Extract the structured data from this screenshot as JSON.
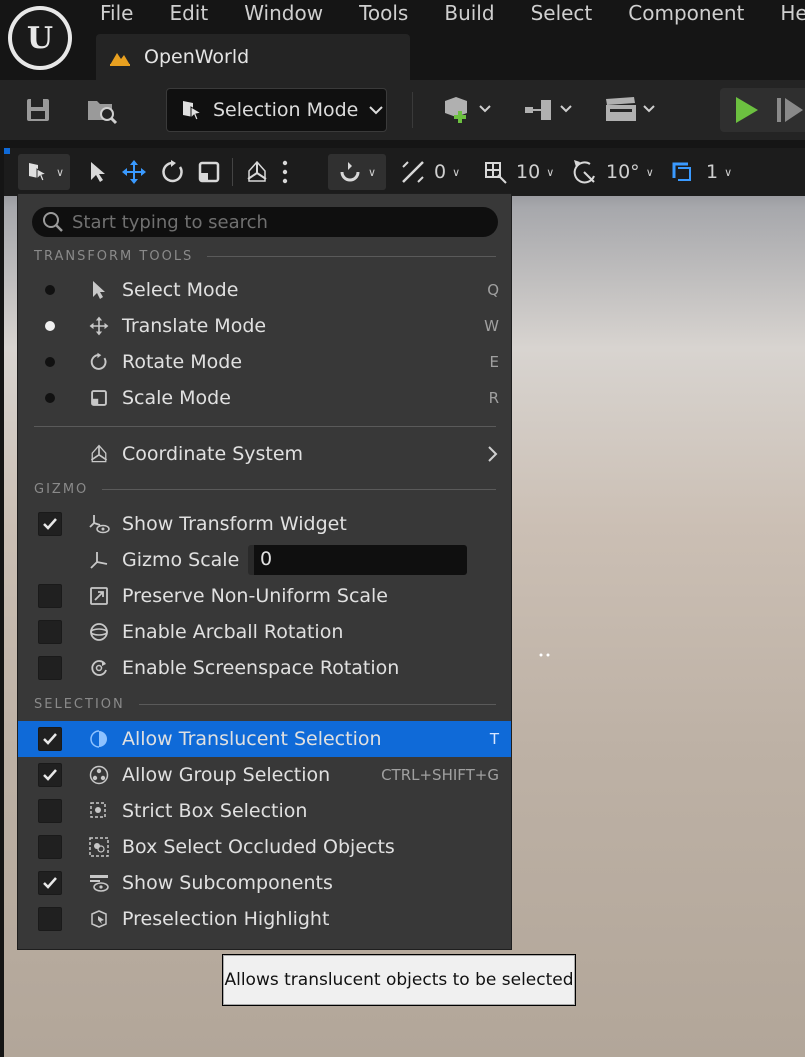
{
  "menubar": [
    "File",
    "Edit",
    "Window",
    "Tools",
    "Build",
    "Select",
    "Component",
    "Help"
  ],
  "document_tab": {
    "label": "OpenWorld"
  },
  "toolbar": {
    "mode_label": "Selection Mode"
  },
  "viewport_toolbar": {
    "translate_snap": "0",
    "grid_snap": "10",
    "rotate_snap": "10°",
    "camera_speed": "1"
  },
  "menu": {
    "search_placeholder": "Start typing to search",
    "sections": {
      "transform_tools": "TRANSFORM TOOLS",
      "gizmo": "GIZMO",
      "selection": "SELECTION"
    },
    "transform_items": [
      {
        "label": "Select Mode",
        "shortcut": "Q",
        "selected": false
      },
      {
        "label": "Translate Mode",
        "shortcut": "W",
        "selected": true
      },
      {
        "label": "Rotate Mode",
        "shortcut": "E",
        "selected": false
      },
      {
        "label": "Scale Mode",
        "shortcut": "R",
        "selected": false
      }
    ],
    "coordinate_system": "Coordinate System",
    "gizmo_items": {
      "show_transform_widget": {
        "label": "Show Transform Widget",
        "checked": true
      },
      "gizmo_scale": {
        "label": "Gizmo Scale",
        "value": "0"
      },
      "preserve_non_uniform_scale": {
        "label": "Preserve Non-Uniform Scale",
        "checked": false
      },
      "enable_arcball_rotation": {
        "label": "Enable Arcball Rotation",
        "checked": false
      },
      "enable_screenspace_rotation": {
        "label": "Enable Screenspace Rotation",
        "checked": false
      }
    },
    "selection_items": [
      {
        "label": "Allow Translucent Selection",
        "shortcut": "T",
        "checked": true,
        "highlighted": true
      },
      {
        "label": "Allow Group Selection",
        "shortcut": "CTRL+SHIFT+G",
        "checked": true,
        "highlighted": false
      },
      {
        "label": "Strict Box Selection",
        "shortcut": "",
        "checked": false,
        "highlighted": false
      },
      {
        "label": "Box Select Occluded Objects",
        "shortcut": "",
        "checked": false,
        "highlighted": false
      },
      {
        "label": "Show Subcomponents",
        "shortcut": "",
        "checked": true,
        "highlighted": false
      },
      {
        "label": "Preselection Highlight",
        "shortcut": "",
        "checked": false,
        "highlighted": false
      }
    ]
  },
  "tooltip": {
    "text": "Allows translucent objects to be selected"
  },
  "colors": {
    "highlight": "#0f6ad8",
    "play": "#6cc040",
    "menu_bg": "#383838"
  }
}
